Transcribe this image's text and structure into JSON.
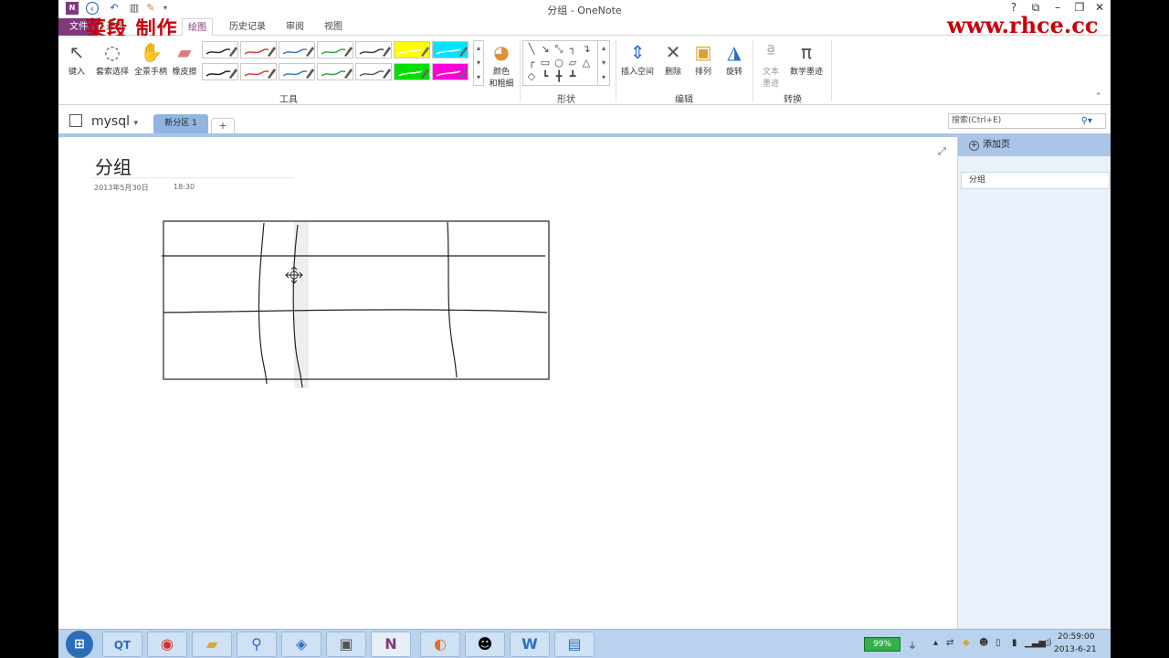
{
  "window": {
    "title": "分组 - OneNote",
    "controls": [
      "?",
      "⧉",
      "–",
      "⧉",
      "✕"
    ]
  },
  "watermark": {
    "left": "菜段 制作",
    "right": "www.rhce.cc"
  },
  "ribbon_tabs": {
    "file": "文件",
    "start": "开始",
    "draw": "绘图",
    "history": "历史记录",
    "review": "审阅",
    "view": "视图"
  },
  "ribbon": {
    "tools_group": "工具",
    "shapes_group": "形状",
    "edit_group": "编辑",
    "convert_group": "转换",
    "type_btn": "键入",
    "lasso_btn": "套索选择",
    "pan_btn": "全景手柄",
    "eraser_btn": "橡皮擦",
    "color_btn_1": "颜色",
    "color_btn_2": "和粗细",
    "insert_space_btn": "插入空间",
    "delete_btn": "删除",
    "arrange_btn": "排列",
    "rotate_btn": "旋转",
    "ink_to_text_1": "文本",
    "ink_to_text_2": "墨迹",
    "math_ink_btn": "数学墨迹",
    "pens": [
      {
        "color": "#222222",
        "highlight": false
      },
      {
        "color": "#d23030",
        "highlight": false
      },
      {
        "color": "#2d6fc4",
        "highlight": false
      },
      {
        "color": "#2a9a3a",
        "highlight": false
      },
      {
        "color": "#333333",
        "highlight": false
      },
      {
        "color": "#ffff00",
        "highlight": true
      },
      {
        "color": "#00e5ff",
        "highlight": true
      },
      {
        "color": "#111111",
        "highlight": false
      },
      {
        "color": "#d23030",
        "highlight": false
      },
      {
        "color": "#2d6fc4",
        "highlight": false
      },
      {
        "color": "#2a9a3a",
        "highlight": false
      },
      {
        "color": "#555555",
        "highlight": false
      },
      {
        "color": "#00e000",
        "highlight": true
      },
      {
        "color": "#ff00d8",
        "highlight": true
      }
    ]
  },
  "notebook": {
    "name": "mysql",
    "section": "新分区 1",
    "add_section": "+",
    "search_placeholder": "搜索(Ctrl+E)"
  },
  "page": {
    "title": "分组",
    "date": "2013年5月30日",
    "time": "18:30"
  },
  "pagelist": {
    "add_page": "添加页",
    "pages": [
      "分组"
    ]
  },
  "taskbar": {
    "battery": "99%",
    "time": "20:59:00",
    "date": "2013-6-21"
  }
}
